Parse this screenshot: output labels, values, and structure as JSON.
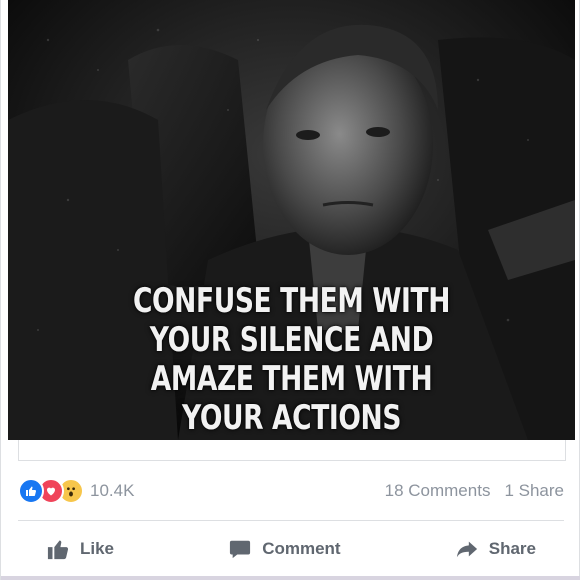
{
  "post": {
    "image_text_lines": [
      "CONFUSE THEM WITH",
      "YOUR SILENCE AND",
      "AMAZE THEM WITH",
      "YOUR ACTIONS"
    ],
    "reactions": {
      "icons": [
        "like-icon",
        "love-icon",
        "wow-icon"
      ],
      "count": "10.4K"
    },
    "comments_label": "18 Comments",
    "shares_label": "1 Share"
  },
  "actions": {
    "like_label": "Like",
    "comment_label": "Comment",
    "share_label": "Share"
  },
  "colors": {
    "like_blue": "#1877f2",
    "love_red": "#f0445a",
    "wow_yellow": "#f7c64b",
    "action_gray": "#606770",
    "meta_gray": "#8d949e"
  }
}
